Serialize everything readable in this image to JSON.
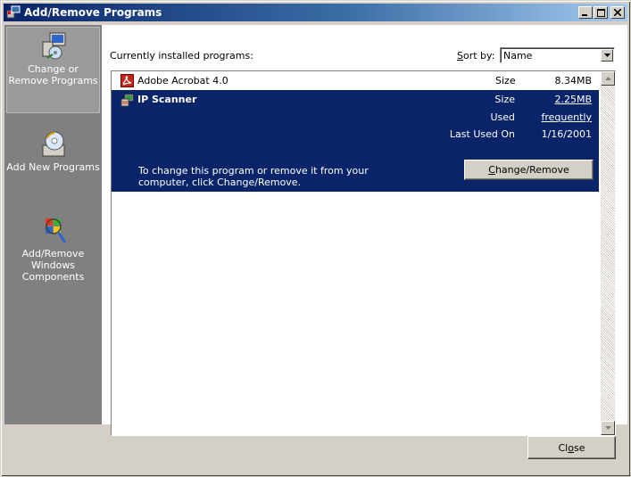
{
  "window": {
    "title": "Add/Remove Programs"
  },
  "sidebar": {
    "items": [
      {
        "label": "Change or Remove Programs",
        "selected": true
      },
      {
        "label": "Add New Programs",
        "selected": false
      },
      {
        "label": "Add/Remove Windows Components",
        "selected": false
      }
    ]
  },
  "main": {
    "installed_label": "Currently installed programs:",
    "sort_label_pre": "",
    "sort_label_key": "S",
    "sort_label_rest": "ort by:",
    "sort_value": "Name"
  },
  "programs": [
    {
      "name": "Adobe Acrobat 4.0",
      "size_label": "Size",
      "size": "8.34MB"
    },
    {
      "name": "IP Scanner",
      "size_label": "Size",
      "size": "2.25MB",
      "used_label": "Used",
      "used": "frequently",
      "last_used_label": "Last Used On",
      "last_used": "1/16/2001",
      "description": "To change this program or remove it from your computer, click Change/Remove.",
      "button_key": "C",
      "button_rest": "hange/Remove"
    }
  ],
  "footer": {
    "close_pre": "Cl",
    "close_key": "o",
    "close_rest": "se"
  },
  "colors": {
    "selection": "#0a246a",
    "sidebar": "#808080",
    "face": "#d4d0c8"
  }
}
